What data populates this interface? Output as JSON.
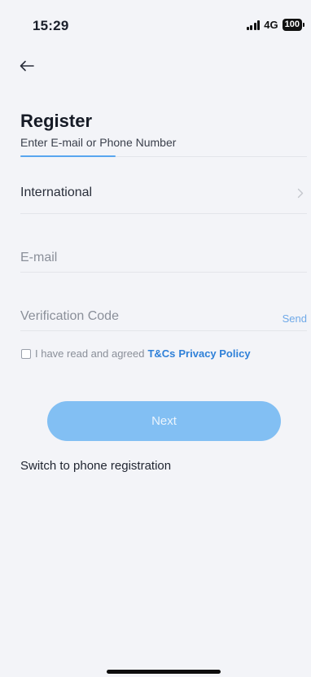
{
  "status_bar": {
    "time": "15:29",
    "network": "4G",
    "battery": "100"
  },
  "header": {
    "back_icon": "arrow-left-icon",
    "title": "Register",
    "subtitle": "Enter E-mail or Phone Number"
  },
  "form": {
    "country": {
      "label": "International",
      "icon": "chevron-right-icon"
    },
    "email": {
      "placeholder": "E-mail",
      "value": ""
    },
    "code": {
      "placeholder": "Verification Code",
      "value": "",
      "send_label": "Send"
    },
    "agreement": {
      "checked": false,
      "text": "I have read and agreed",
      "link_terms": "T&Cs",
      "link_privacy": "Privacy Policy"
    }
  },
  "actions": {
    "next_label": "Next",
    "switch_label": "Switch to phone registration"
  },
  "colors": {
    "background": "#f3f4f8",
    "accent": "#58a6ef",
    "link": "#2f80d8",
    "button": "#82bff3"
  }
}
